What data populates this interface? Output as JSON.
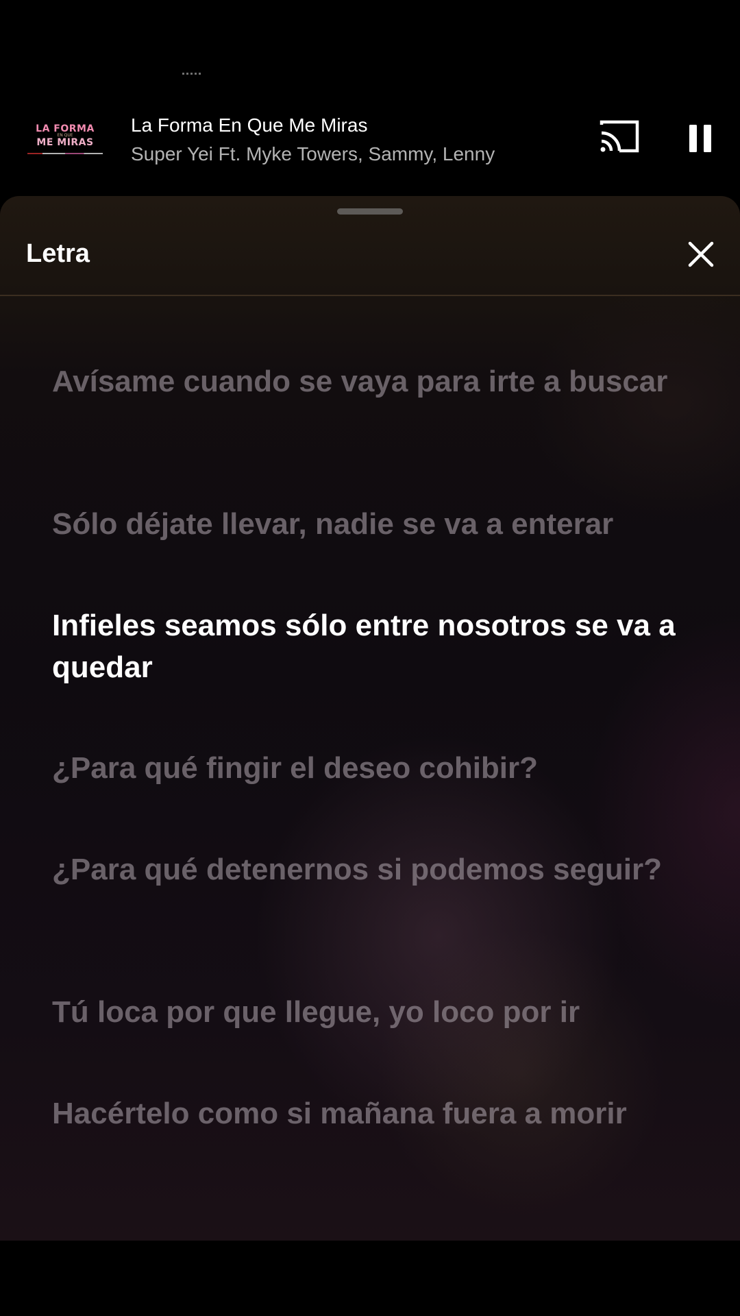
{
  "now_playing": {
    "album_art": {
      "line1": "LA FORMA",
      "line2": "EN QUE",
      "line3": "ME MIRAS"
    },
    "title": "La Forma En Que Me Miras",
    "artist": "Super Yei Ft. Myke Towers, Sammy, Lenny",
    "cast_icon": "cast-icon",
    "pause_icon": "pause-icon"
  },
  "lyrics_sheet": {
    "title": "Letra",
    "close_icon": "close-icon",
    "lines": [
      "Avísame cuando se vaya para irte a buscar",
      "Sólo déjate llevar, nadie se va a enterar",
      "Infieles seamos sólo entre nosotros se va a quedar",
      "¿Para qué fingir el deseo cohibir?",
      "¿Para qué detenernos si podemos seguir?",
      "Tú loca por que llegue, yo loco por ir",
      "Hacértelo como si mañana fuera a morir"
    ],
    "active_line_index": 2
  },
  "colors": {
    "active_lyric": "#ffffff",
    "inactive_lyric": "#a0969e",
    "background": "#000000"
  }
}
